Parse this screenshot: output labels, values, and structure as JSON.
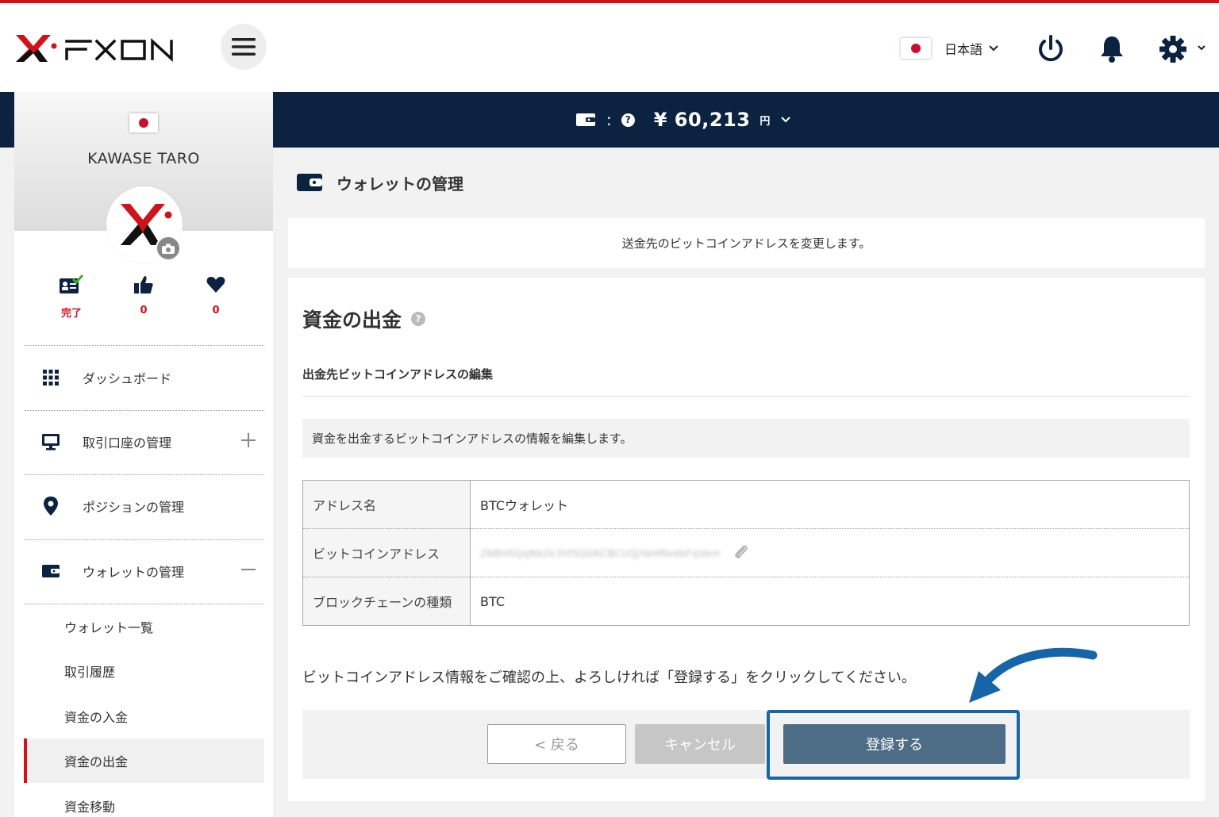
{
  "header": {
    "brand": "FXON",
    "language": "日本語",
    "icons": [
      "menu-icon",
      "flag-japan-icon",
      "chevron-down-icon",
      "power-icon",
      "bell-icon",
      "gear-icon"
    ]
  },
  "balance": {
    "colon": ":",
    "help": "?",
    "amount": "¥ 60,213",
    "unit": "円"
  },
  "profile": {
    "name": "KAWASE TARO",
    "stats": [
      {
        "icon": "id-card-verified-icon",
        "value": "完了"
      },
      {
        "icon": "thumbs-up-icon",
        "value": "0"
      },
      {
        "icon": "heart-icon",
        "value": "0"
      }
    ]
  },
  "sidebar": {
    "items": [
      {
        "label": "ダッシュボード",
        "icon": "grid-icon"
      },
      {
        "label": "取引口座の管理",
        "icon": "monitor-icon",
        "toggle": "+"
      },
      {
        "label": "ポジションの管理",
        "icon": "map-pin-icon"
      },
      {
        "label": "ウォレットの管理",
        "icon": "wallet-icon",
        "toggle": "−"
      }
    ],
    "sub_items": [
      {
        "label": "ウォレット一覧"
      },
      {
        "label": "取引履歴"
      },
      {
        "label": "資金の入金"
      },
      {
        "label": "資金の出金",
        "active": true
      },
      {
        "label": "資金移動"
      }
    ]
  },
  "page": {
    "title": "ウォレットの管理",
    "notice": "送金先のビットコインアドレスを変更します。"
  },
  "withdraw": {
    "title": "資金の出金",
    "help": "?",
    "subheading": "出金先ビットコインアドレスの編集",
    "info": "資金を出金するビットコインアドレスの情報を編集します。",
    "rows": [
      {
        "label": "アドレス名",
        "value": "BTCウォレット"
      },
      {
        "label": "ビットコインアドレス",
        "value": "2NBHSQqNb2k3hfSQGKCBCUQjYaHMe4bFqVem"
      },
      {
        "label": "ブロックチェーンの種類",
        "value": "BTC"
      }
    ],
    "confirm": "ビットコインアドレス情報をご確認の上、よろしければ「登録する」をクリックしてください。",
    "buttons": {
      "back": "< 戻る",
      "cancel": "キャンセル",
      "register": "登録する"
    }
  },
  "colors": {
    "brand_red": "#d0121b",
    "navy": "#0b2340",
    "register_button": "#4d6c86",
    "highlight": "#1565a8"
  }
}
